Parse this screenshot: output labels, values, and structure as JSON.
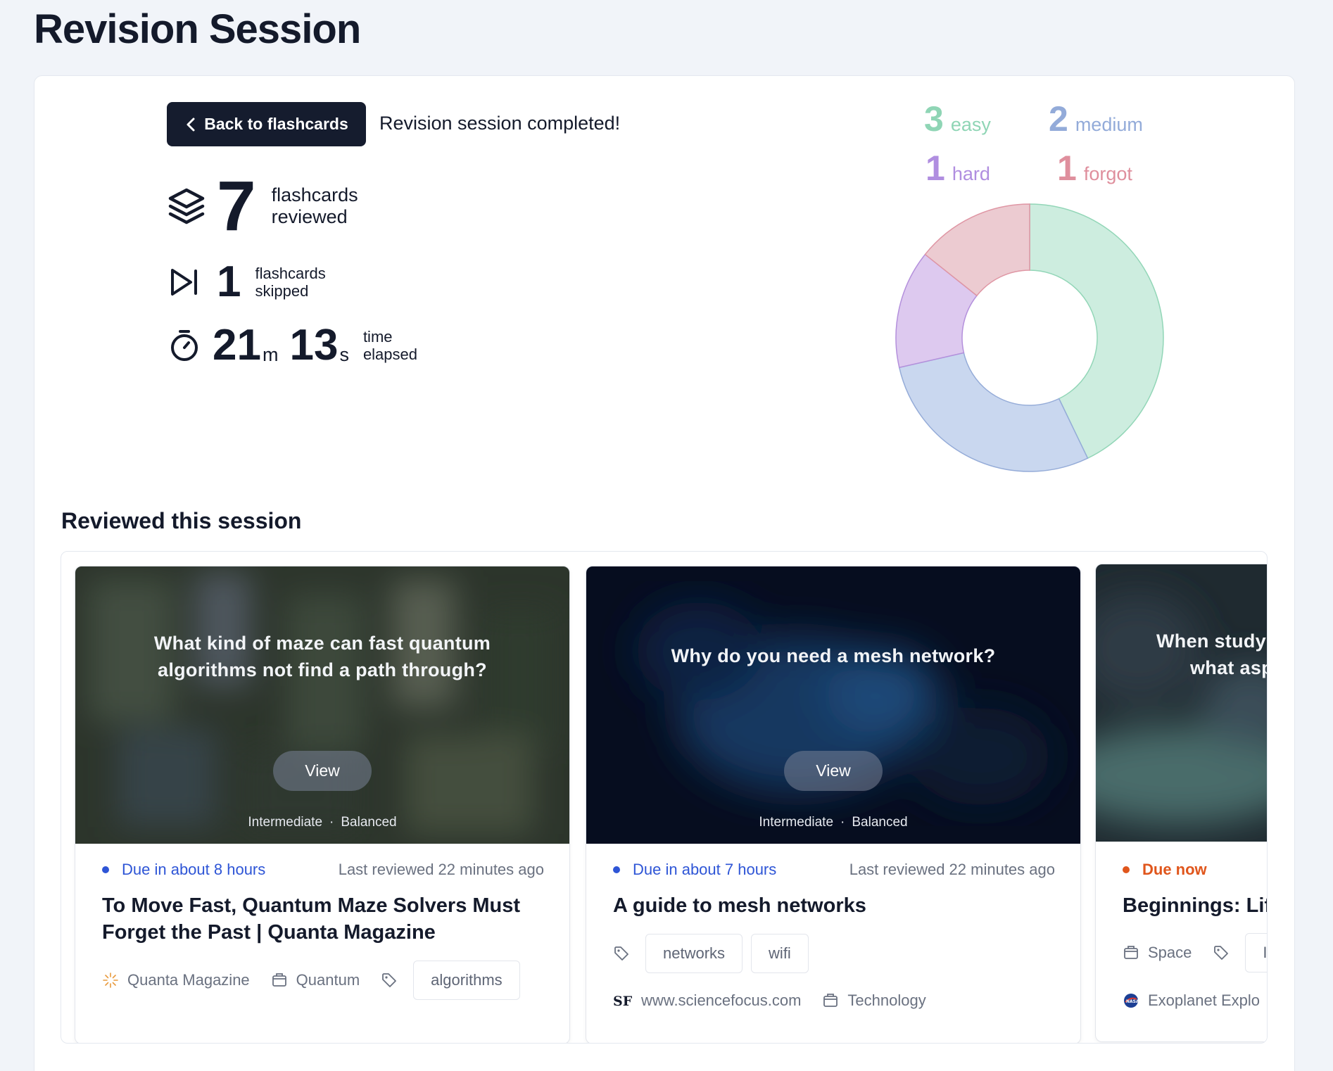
{
  "page": {
    "title": "Revision Session"
  },
  "header": {
    "back_label": "Back to flashcards",
    "completed_text": "Revision session completed!"
  },
  "stats": {
    "reviewed": {
      "value": "7",
      "label_1": "flashcards",
      "label_2": "reviewed",
      "icon": "stack-icon"
    },
    "skipped": {
      "value": "1",
      "label_1": "flashcards",
      "label_2": "skipped",
      "icon": "skip-icon"
    },
    "time": {
      "minutes": "21",
      "minutes_unit": "m",
      "seconds": "13",
      "seconds_unit": "s",
      "label_1": "time",
      "label_2": "elapsed",
      "icon": "stopwatch-icon"
    }
  },
  "chart_data": {
    "type": "pie",
    "categories": [
      "easy",
      "medium",
      "hard",
      "forgot"
    ],
    "values": [
      3,
      2,
      1,
      1
    ],
    "colors": {
      "easy": {
        "fill": "#cdeddf",
        "stroke": "#92d6b7",
        "text": "#8fd5b5"
      },
      "medium": {
        "fill": "#c9d7ef",
        "stroke": "#95acd8",
        "text": "#93abd9"
      },
      "hard": {
        "fill": "#ddc9ef",
        "stroke": "#b490dc",
        "text": "#b08ee0"
      },
      "forgot": {
        "fill": "#eccbd1",
        "stroke": "#df96a4",
        "text": "#df8f9d"
      }
    }
  },
  "legend": [
    {
      "count": "3",
      "label": "easy"
    },
    {
      "count": "2",
      "label": "medium"
    },
    {
      "count": "1",
      "label": "hard"
    },
    {
      "count": "1",
      "label": "forgot"
    }
  ],
  "section": {
    "title": "Reviewed this session"
  },
  "cards": [
    {
      "question": "What kind of maze can fast quantum algorithms not find a path through?",
      "view_label": "View",
      "level": "Intermediate",
      "style": "Balanced",
      "due": "Due in about 8 hours",
      "due_color": "#2e55d6",
      "last_reviewed": "Last reviewed 22 minutes ago",
      "title": "To Move Fast, Quantum Maze Solvers Must Forget the Past | Quanta Magazine",
      "source": "Quanta Magazine",
      "source_icon": "quanta-logo-icon",
      "category": "Quantum",
      "tags": [
        "algorithms"
      ]
    },
    {
      "question": "Why do you need a mesh network?",
      "view_label": "View",
      "level": "Intermediate",
      "style": "Balanced",
      "due": "Due in about 7 hours",
      "due_color": "#2e55d6",
      "last_reviewed": "Last reviewed 22 minutes ago",
      "title": "A guide to mesh networks",
      "tags": [
        "networks",
        "wifi"
      ],
      "source": "www.sciencefocus.com",
      "source_icon": "sciencefocus-logo-icon",
      "category": "Technology"
    },
    {
      "question": "When studyi what aspe",
      "due": "Due now",
      "due_color": "#e0561c",
      "title": "Beginnings: Life",
      "category": "Space",
      "tag_partial": "I",
      "source": "Exoplanet Explo",
      "source_icon": "nasa-logo-icon"
    }
  ]
}
